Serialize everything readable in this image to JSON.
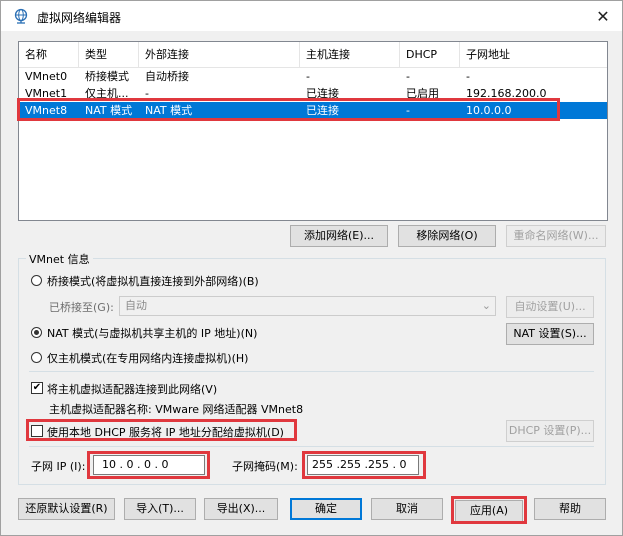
{
  "window": {
    "title": "虚拟网络编辑器",
    "close_glyph": "✕"
  },
  "table": {
    "columns": [
      "名称",
      "类型",
      "外部连接",
      "主机连接",
      "DHCP",
      "子网地址"
    ],
    "rows": [
      [
        "VMnet0",
        "桥接模式",
        "自动桥接",
        "-",
        "-",
        "-"
      ],
      [
        "VMnet1",
        "仅主机...",
        "-",
        "已连接",
        "已启用",
        "192.168.200.0"
      ],
      [
        "VMnet8",
        "NAT 模式",
        "NAT 模式",
        "已连接",
        "-",
        "10.0.0.0"
      ]
    ],
    "selected_index": 2
  },
  "net_buttons": {
    "add": "添加网络(E)...",
    "remove": "移除网络(O)",
    "rename": "重命名网络(W)..."
  },
  "vmnet_info": {
    "title": "VMnet 信息",
    "bridge_label": "桥接模式(将虚拟机直接连接到外部网络)(B)",
    "bridged_to_label": "已桥接至(G):",
    "bridged_to_value": "自动",
    "auto_settings": "自动设置(U)...",
    "nat_label": "NAT 模式(与虚拟机共享主机的 IP 地址)(N)",
    "nat_settings": "NAT 设置(S)...",
    "hostonly_label": "仅主机模式(在专用网络内连接虚拟机)(H)",
    "connect_adapter_label": "将主机虚拟适配器连接到此网络(V)",
    "connect_adapter_checked": true,
    "adapter_name_label": "主机虚拟适配器名称: VMware 网络适配器 VMnet8",
    "dhcp_label": "使用本地 DHCP 服务将 IP 地址分配给虚拟机(D)",
    "dhcp_checked": false,
    "dhcp_settings": "DHCP 设置(P)...",
    "subnet_ip_label": "子网 IP (I):",
    "subnet_ip_value": "10 . 0 . 0 . 0",
    "subnet_mask_label": "子网掩码(M):",
    "subnet_mask_value": "255 .255 .255 . 0",
    "selected_mode": "nat"
  },
  "footer": {
    "restore": "还原默认设置(R)",
    "import": "导入(T)...",
    "export": "导出(X)...",
    "ok": "确定",
    "cancel": "取消",
    "apply": "应用(A)",
    "help": "帮助"
  },
  "colors": {
    "highlight": "#e0383e",
    "selection": "#0078d7"
  }
}
